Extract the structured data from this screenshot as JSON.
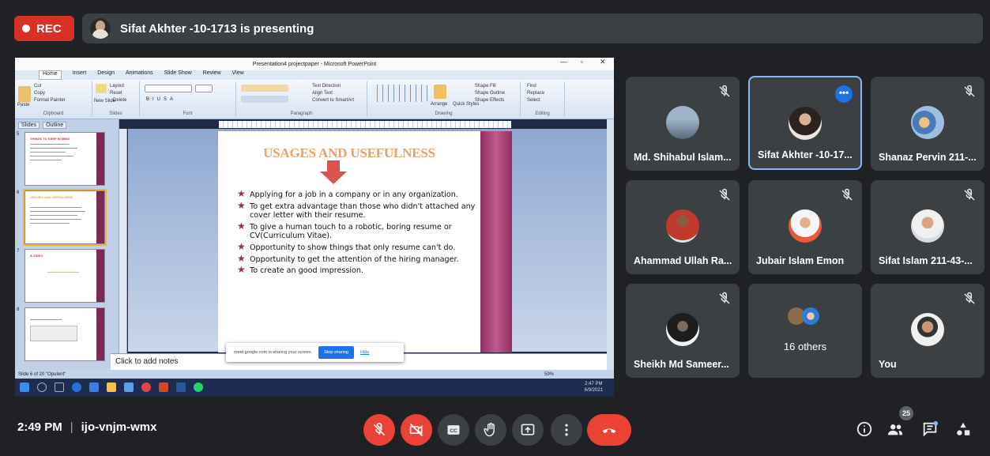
{
  "top": {
    "rec_label": "REC",
    "presenting_text": "Sifat Akhter -10-1713 is presenting"
  },
  "ppt": {
    "window_title": "Presentation4 projectpaper - Microsoft PowerPoint",
    "ribbon_tabs": [
      "Home",
      "Insert",
      "Design",
      "Animations",
      "Slide Show",
      "Review",
      "View"
    ],
    "ribbon_groups": {
      "clipboard": [
        "Cut",
        "Copy",
        "Format Painter",
        "Paste",
        "Clipboard"
      ],
      "slides": [
        "Layout",
        "Reset",
        "New Slide",
        "Delete",
        "Slides"
      ],
      "font": "Font",
      "paragraph": [
        "Text Direction",
        "Align Text",
        "Convert to SmartArt",
        "Paragraph"
      ],
      "drawing": [
        "Shape Fill",
        "Shape Outline",
        "Shape Effects",
        "Arrange",
        "Quick Styles",
        "Drawing"
      ],
      "editing": [
        "Find",
        "Replace",
        "Select",
        "Editing"
      ]
    },
    "pane_tabs": [
      "Slides",
      "Outline"
    ],
    "thumb_numbers": [
      "5",
      "6",
      "7",
      "8"
    ],
    "thumb_titles": [
      "THINGS TO KEEP IN MIND",
      "USAGES AND USEFULNESS",
      "A VIDEO",
      ""
    ],
    "slide_title": "USAGES AND USEFULNESS",
    "bullets": [
      "Applying for a job in a company or in any organization.",
      "To get extra advantage than those who didn't attached any cover letter with their resume.",
      "To give a human touch to a robotic, boring resume or CV(Curriculum Vitae).",
      "Opportunity to show things that only resume can't do.",
      "Opportunity to get the attention of the hiring manager.",
      "To create an good impression."
    ],
    "notes_placeholder": "Click to add notes",
    "share_text": "meet.google.com is sharing your screen.",
    "stop_sharing": "Stop sharing",
    "hide": "Hide",
    "status_text": "Slide 6 of 20   \"Opulent\"",
    "zoom": "59%",
    "taskbar_time": "2:47 PM",
    "taskbar_date": "6/9/2021"
  },
  "participants": [
    {
      "name": "Md. Shihabul Islam...",
      "muted": true
    },
    {
      "name": "Sifat Akhter -10-17...",
      "muted": false,
      "active": true
    },
    {
      "name": "Shanaz Pervin 211-...",
      "muted": true
    },
    {
      "name": "Ahammad Ullah Ra...",
      "muted": true
    },
    {
      "name": "Jubair Islam Emon",
      "muted": true
    },
    {
      "name": "Sifat Islam 211-43-...",
      "muted": true
    },
    {
      "name": "Sheikh Md Sameer...",
      "muted": true
    },
    {
      "name": "16 others",
      "muted": false
    },
    {
      "name": "You",
      "muted": true
    }
  ],
  "bottom": {
    "time": "2:49 PM",
    "separator": "|",
    "meeting_code": "ijo-vnjm-wmx",
    "people_count": "25"
  },
  "colors": {
    "accent": "#1a73e8",
    "danger": "#ea4335",
    "tile": "#3c4043",
    "background": "#202124"
  }
}
